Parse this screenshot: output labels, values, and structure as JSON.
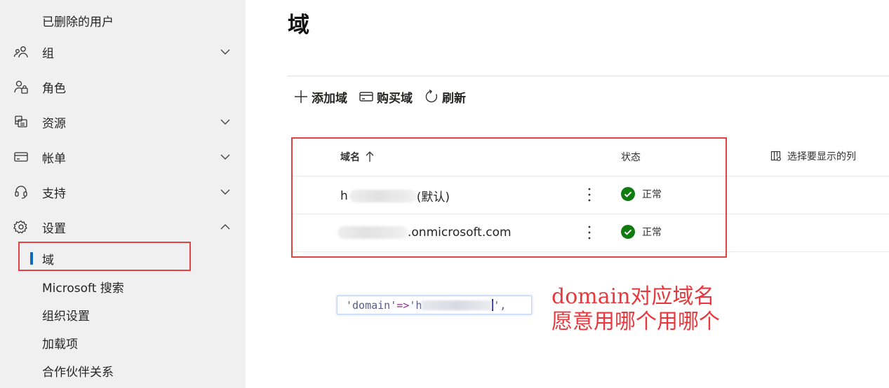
{
  "sidebar": {
    "items": [
      {
        "label": "已删除的用户"
      },
      {
        "label": "组",
        "icon": "group-icon",
        "expanded": false
      },
      {
        "label": "角色",
        "icon": "role-icon"
      },
      {
        "label": "资源",
        "icon": "resources-icon",
        "expanded": false
      },
      {
        "label": "帐单",
        "icon": "billing-icon",
        "expanded": false
      },
      {
        "label": "支持",
        "icon": "headset-icon",
        "expanded": false
      },
      {
        "label": "设置",
        "icon": "gear-icon",
        "expanded": true
      }
    ],
    "settings_sub": [
      {
        "label": "域",
        "active": true
      },
      {
        "label": "Microsoft 搜索"
      },
      {
        "label": "组织设置"
      },
      {
        "label": "加载项"
      },
      {
        "label": "合作伙伴关系"
      }
    ],
    "active_accent": "#0f6cbd"
  },
  "page": {
    "title": "域"
  },
  "toolbar": {
    "add_label": "添加域",
    "buy_label": "购买域",
    "refresh_label": "刷新"
  },
  "table": {
    "columns": {
      "name": "域名",
      "sort_icon": "arrow-up-icon",
      "status": "状态"
    },
    "column_chooser": "选择要显示的列",
    "rows": [
      {
        "prefix": "h",
        "suffix": "(默认)",
        "status": "正常"
      },
      {
        "prefix": "",
        "suffix": ".onmicrosoft.com",
        "status": "正常"
      }
    ],
    "status_color": "#107c10"
  },
  "code_snippet": {
    "key": "'domain'",
    "arrow": "=>",
    "value_start": "'h",
    "value_end": "',"
  },
  "annotation": {
    "line1": "domain对应域名",
    "line2": "愿意用哪个用哪个",
    "color": "#e8383d"
  },
  "highlight_color": "#e04343"
}
